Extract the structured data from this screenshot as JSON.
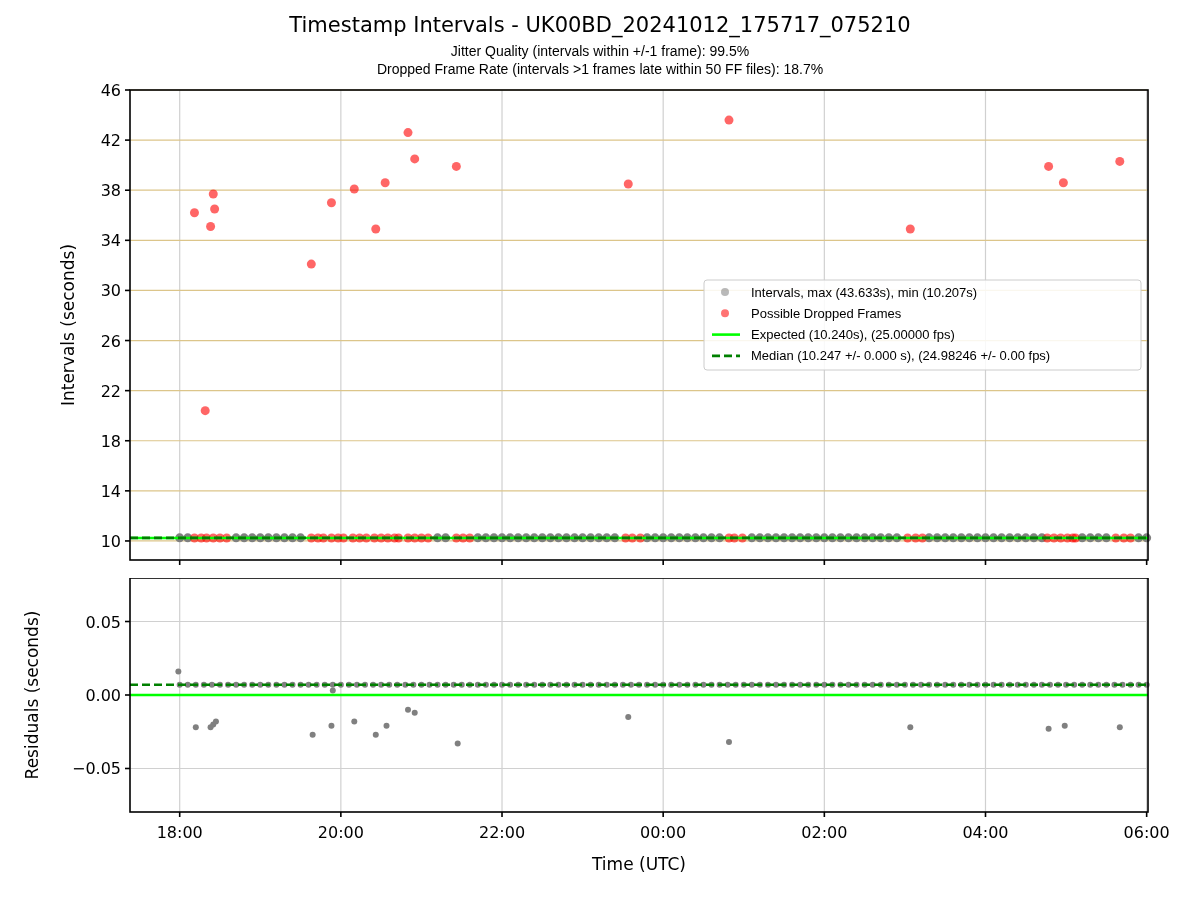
{
  "title": "Timestamp Intervals - UK00BD_20241012_175717_075210",
  "subtitles": [
    "Jitter Quality (intervals within +/-1 frame): 99.5%",
    "Dropped Frame Rate (intervals >1 frames late within 50 FF files): 18.7%"
  ],
  "intervals_chart": {
    "chart_data": {
      "type": "scatter",
      "ylabel": "Intervals (seconds)",
      "xlim": [
        "2024-10-12T17:23",
        "2024-10-13T06:01"
      ],
      "ylim": [
        8.48,
        46
      ],
      "grid": true,
      "legend": true,
      "yticks": [
        10,
        14,
        18,
        22,
        26,
        30,
        34,
        38,
        42,
        46
      ],
      "series": [
        {
          "name": "Intervals, max (43.633s), min (10.207s)",
          "color": "#808080",
          "x": [
            "2024-10-12T18:00",
            "2024-10-12T18:06",
            "2024-10-12T18:42",
            "2024-10-12T18:48",
            "2024-10-12T18:54",
            "2024-10-12T19:00",
            "2024-10-12T19:06",
            "2024-10-12T19:12",
            "2024-10-12T19:18",
            "2024-10-12T19:24",
            "2024-10-12T19:30",
            "2024-10-12T21:12",
            "2024-10-12T21:18",
            "2024-10-12T21:42",
            "2024-10-12T21:48",
            "2024-10-12T21:54",
            "2024-10-12T22:00",
            "2024-10-12T22:06",
            "2024-10-12T22:12",
            "2024-10-12T22:18",
            "2024-10-12T22:24",
            "2024-10-12T22:30",
            "2024-10-12T22:36",
            "2024-10-12T22:42",
            "2024-10-12T22:48",
            "2024-10-12T22:54",
            "2024-10-12T23:00",
            "2024-10-12T23:06",
            "2024-10-12T23:12",
            "2024-10-12T23:18",
            "2024-10-12T23:24",
            "2024-10-12T23:48",
            "2024-10-12T23:54",
            "2024-10-13T00:00",
            "2024-10-13T00:06",
            "2024-10-13T00:12",
            "2024-10-13T00:18",
            "2024-10-13T00:24",
            "2024-10-13T00:30",
            "2024-10-13T00:36",
            "2024-10-13T00:42",
            "2024-10-13T01:06",
            "2024-10-13T01:12",
            "2024-10-13T01:18",
            "2024-10-13T01:24",
            "2024-10-13T01:30",
            "2024-10-13T01:36",
            "2024-10-13T01:42",
            "2024-10-13T01:48",
            "2024-10-13T01:54",
            "2024-10-13T02:00",
            "2024-10-13T02:06",
            "2024-10-13T02:12",
            "2024-10-13T02:18",
            "2024-10-13T02:24",
            "2024-10-13T02:30",
            "2024-10-13T02:36",
            "2024-10-13T02:42",
            "2024-10-13T02:48",
            "2024-10-13T02:54",
            "2024-10-13T03:18",
            "2024-10-13T03:24",
            "2024-10-13T03:30",
            "2024-10-13T03:36",
            "2024-10-13T03:42",
            "2024-10-13T03:48",
            "2024-10-13T03:54",
            "2024-10-13T04:00",
            "2024-10-13T04:06",
            "2024-10-13T04:12",
            "2024-10-13T04:18",
            "2024-10-13T04:24",
            "2024-10-13T04:30",
            "2024-10-13T04:36",
            "2024-10-13T04:42",
            "2024-10-13T05:12",
            "2024-10-13T05:18",
            "2024-10-13T05:24",
            "2024-10-13T05:30",
            "2024-10-13T05:54",
            "2024-10-13T06:00"
          ],
          "values": [
            10.25,
            10.25,
            10.25,
            10.25,
            10.25,
            10.25,
            10.25,
            10.25,
            10.25,
            10.25,
            10.25,
            10.25,
            10.25,
            10.25,
            10.25,
            10.25,
            10.25,
            10.25,
            10.25,
            10.25,
            10.25,
            10.25,
            10.25,
            10.25,
            10.25,
            10.25,
            10.25,
            10.25,
            10.25,
            10.25,
            10.25,
            10.25,
            10.25,
            10.25,
            10.25,
            10.25,
            10.25,
            10.25,
            10.25,
            10.25,
            10.25,
            10.25,
            10.25,
            10.25,
            10.25,
            10.25,
            10.25,
            10.25,
            10.25,
            10.25,
            10.25,
            10.25,
            10.25,
            10.25,
            10.25,
            10.25,
            10.25,
            10.25,
            10.25,
            10.25,
            10.25,
            10.25,
            10.25,
            10.25,
            10.25,
            10.25,
            10.25,
            10.25,
            10.25,
            10.25,
            10.25,
            10.25,
            10.25,
            10.25,
            10.25,
            10.25,
            10.25,
            10.25,
            10.25,
            10.25,
            10.25
          ]
        },
        {
          "name": "Possible Dropped Frames",
          "color": "#ff0000",
          "x": [
            "2024-10-12T18:11",
            "2024-10-12T18:19",
            "2024-10-12T18:23",
            "2024-10-12T18:25",
            "2024-10-12T18:26",
            "2024-10-12T19:38",
            "2024-10-12T19:53",
            "2024-10-12T20:10",
            "2024-10-12T20:26",
            "2024-10-12T20:33",
            "2024-10-12T20:50",
            "2024-10-12T20:55",
            "2024-10-12T21:26",
            "2024-10-12T23:34",
            "2024-10-13T00:49",
            "2024-10-13T03:04",
            "2024-10-13T04:47",
            "2024-10-13T04:58",
            "2024-10-13T05:40",
            "2024-10-12T18:11",
            "2024-10-12T18:16",
            "2024-10-12T18:20",
            "2024-10-12T18:25",
            "2024-10-12T18:30",
            "2024-10-12T18:35",
            "2024-10-12T19:38",
            "2024-10-12T19:43",
            "2024-10-12T19:47",
            "2024-10-12T19:53",
            "2024-10-12T19:58",
            "2024-10-12T20:02",
            "2024-10-12T20:09",
            "2024-10-12T20:14",
            "2024-10-12T20:19",
            "2024-10-12T20:25",
            "2024-10-12T20:30",
            "2024-10-12T20:35",
            "2024-10-12T20:40",
            "2024-10-12T20:43",
            "2024-10-12T20:50",
            "2024-10-12T20:55",
            "2024-10-12T21:00",
            "2024-10-12T21:05",
            "2024-10-12T21:26",
            "2024-10-12T21:31",
            "2024-10-12T21:36",
            "2024-10-12T23:32",
            "2024-10-12T23:37",
            "2024-10-12T23:43",
            "2024-10-13T00:49",
            "2024-10-13T00:53",
            "2024-10-13T00:59",
            "2024-10-13T03:02",
            "2024-10-13T03:08",
            "2024-10-13T03:13",
            "2024-10-13T04:46",
            "2024-10-13T04:51",
            "2024-10-13T04:56",
            "2024-10-13T05:01",
            "2024-10-13T05:05",
            "2024-10-13T05:07",
            "2024-10-13T05:37",
            "2024-10-13T05:43",
            "2024-10-13T05:48"
          ],
          "values": [
            36.2,
            20.4,
            35.1,
            37.7,
            36.5,
            32.1,
            37.0,
            38.1,
            34.9,
            38.6,
            42.6,
            40.5,
            39.9,
            38.5,
            43.6,
            34.9,
            39.9,
            38.6,
            40.3,
            10.24,
            10.24,
            10.24,
            10.24,
            10.24,
            10.24,
            10.24,
            10.24,
            10.24,
            10.24,
            10.24,
            10.24,
            10.24,
            10.24,
            10.24,
            10.24,
            10.24,
            10.24,
            10.24,
            10.24,
            10.24,
            10.24,
            10.24,
            10.24,
            10.24,
            10.24,
            10.24,
            10.24,
            10.24,
            10.24,
            10.24,
            10.24,
            10.24,
            10.24,
            10.24,
            10.24,
            10.24,
            10.24,
            10.24,
            10.24,
            10.24,
            10.24,
            10.24,
            10.24,
            10.24
          ]
        },
        {
          "type": "line",
          "line_style": "solid",
          "name": "Expected (10.240s), (25.00000 fps)",
          "color": "#00ff00",
          "x": [
            "2024-10-12T17:23",
            "2024-10-13T06:01"
          ],
          "values": [
            10.24,
            10.24
          ]
        },
        {
          "type": "line",
          "line_style": "dashed",
          "name": "Median (10.247 +/- 0.000 s), (24.98246 +/- 0.00 fps)",
          "color": "#008000",
          "x": [
            "2024-10-12T17:23",
            "2024-10-13T06:01"
          ],
          "values": [
            10.247,
            10.247
          ]
        }
      ]
    }
  },
  "residuals_chart": {
    "chart_data": {
      "type": "scatter",
      "xlabel": "Time (UTC)",
      "ylabel": "Residuals (seconds)",
      "xlim": [
        "2024-10-12T17:23",
        "2024-10-13T06:01"
      ],
      "ylim": [
        -0.0796,
        0.0796
      ],
      "grid": true,
      "xticks": [
        {
          "value": "2024-10-12T18:00",
          "label": "18:00"
        },
        {
          "value": "2024-10-12T20:00",
          "label": "20:00"
        },
        {
          "value": "2024-10-12T22:00",
          "label": "22:00"
        },
        {
          "value": "2024-10-13T00:00",
          "label": "00:00"
        },
        {
          "value": "2024-10-13T02:00",
          "label": "02:00"
        },
        {
          "value": "2024-10-13T04:00",
          "label": "04:00"
        },
        {
          "value": "2024-10-13T06:00",
          "label": "06:00"
        }
      ],
      "yticks": [
        {
          "value": 0.05,
          "label": "0.05"
        },
        {
          "value": 0,
          "label": "0.00"
        },
        {
          "value": -0.05,
          "label": "−0.05"
        }
      ],
      "series": [
        {
          "color": "#808080",
          "x": [
            "2024-10-12T17:59",
            "2024-10-12T18:12",
            "2024-10-12T18:23",
            "2024-10-12T18:25",
            "2024-10-12T18:27",
            "2024-10-12T19:39",
            "2024-10-12T19:53",
            "2024-10-12T19:54",
            "2024-10-12T20:10",
            "2024-10-12T20:26",
            "2024-10-12T20:34",
            "2024-10-12T20:50",
            "2024-10-12T20:55",
            "2024-10-12T21:27",
            "2024-10-12T23:34",
            "2024-10-13T00:49",
            "2024-10-13T03:04",
            "2024-10-13T04:47",
            "2024-10-13T04:59",
            "2024-10-13T05:40",
            "2024-10-12T18:00",
            "2024-10-12T18:06",
            "2024-10-12T18:12",
            "2024-10-12T18:18",
            "2024-10-12T18:24",
            "2024-10-12T18:30",
            "2024-10-12T18:36",
            "2024-10-12T18:42",
            "2024-10-12T18:48",
            "2024-10-12T18:54",
            "2024-10-12T19:00",
            "2024-10-12T19:06",
            "2024-10-12T19:12",
            "2024-10-12T19:18",
            "2024-10-12T19:24",
            "2024-10-12T19:30",
            "2024-10-12T19:36",
            "2024-10-12T19:42",
            "2024-10-12T19:48",
            "2024-10-12T19:54",
            "2024-10-12T20:00",
            "2024-10-12T20:06",
            "2024-10-12T20:12",
            "2024-10-12T20:18",
            "2024-10-12T20:24",
            "2024-10-12T20:30",
            "2024-10-12T20:36",
            "2024-10-12T20:42",
            "2024-10-12T20:48",
            "2024-10-12T20:54",
            "2024-10-12T21:00",
            "2024-10-12T21:06",
            "2024-10-12T21:12",
            "2024-10-12T21:18",
            "2024-10-12T21:24",
            "2024-10-12T21:30",
            "2024-10-12T21:36",
            "2024-10-12T21:42",
            "2024-10-12T21:48",
            "2024-10-12T21:54",
            "2024-10-12T22:00",
            "2024-10-12T22:06",
            "2024-10-12T22:12",
            "2024-10-12T22:18",
            "2024-10-12T22:24",
            "2024-10-12T22:30",
            "2024-10-12T22:36",
            "2024-10-12T22:42",
            "2024-10-12T22:48",
            "2024-10-12T22:54",
            "2024-10-12T23:00",
            "2024-10-12T23:06",
            "2024-10-12T23:12",
            "2024-10-12T23:18",
            "2024-10-12T23:24",
            "2024-10-12T23:30",
            "2024-10-12T23:36",
            "2024-10-12T23:42",
            "2024-10-12T23:48",
            "2024-10-12T23:54",
            "2024-10-13T00:00",
            "2024-10-13T00:06",
            "2024-10-13T00:12",
            "2024-10-13T00:18",
            "2024-10-13T00:24",
            "2024-10-13T00:30",
            "2024-10-13T00:36",
            "2024-10-13T00:42",
            "2024-10-13T00:48",
            "2024-10-13T00:54",
            "2024-10-13T01:00",
            "2024-10-13T01:06",
            "2024-10-13T01:12",
            "2024-10-13T01:18",
            "2024-10-13T01:24",
            "2024-10-13T01:30",
            "2024-10-13T01:36",
            "2024-10-13T01:42",
            "2024-10-13T01:48",
            "2024-10-13T01:54",
            "2024-10-13T02:00",
            "2024-10-13T02:06",
            "2024-10-13T02:12",
            "2024-10-13T02:18",
            "2024-10-13T02:24",
            "2024-10-13T02:30",
            "2024-10-13T02:36",
            "2024-10-13T02:42",
            "2024-10-13T02:48",
            "2024-10-13T02:54",
            "2024-10-13T03:00",
            "2024-10-13T03:06",
            "2024-10-13T03:12",
            "2024-10-13T03:18",
            "2024-10-13T03:24",
            "2024-10-13T03:30",
            "2024-10-13T03:36",
            "2024-10-13T03:42",
            "2024-10-13T03:48",
            "2024-10-13T03:54",
            "2024-10-13T04:00",
            "2024-10-13T04:06",
            "2024-10-13T04:12",
            "2024-10-13T04:18",
            "2024-10-13T04:24",
            "2024-10-13T04:30",
            "2024-10-13T04:36",
            "2024-10-13T04:42",
            "2024-10-13T04:48",
            "2024-10-13T04:54",
            "2024-10-13T05:00",
            "2024-10-13T05:06",
            "2024-10-13T05:12",
            "2024-10-13T05:18",
            "2024-10-13T05:24",
            "2024-10-13T05:30",
            "2024-10-13T05:36",
            "2024-10-13T05:42",
            "2024-10-13T05:48",
            "2024-10-13T05:54",
            "2024-10-13T06:00"
          ],
          "values": [
            0.016,
            -0.022,
            -0.022,
            -0.02,
            -0.018,
            -0.027,
            -0.021,
            0.003,
            -0.018,
            -0.027,
            -0.021,
            -0.01,
            -0.012,
            -0.033,
            -0.015,
            -0.032,
            -0.022,
            -0.023,
            -0.021,
            -0.022,
            0.007,
            0.007,
            0.007,
            0.007,
            0.007,
            0.007,
            0.007,
            0.007,
            0.007,
            0.007,
            0.007,
            0.007,
            0.007,
            0.007,
            0.007,
            0.007,
            0.007,
            0.007,
            0.007,
            0.007,
            0.007,
            0.007,
            0.007,
            0.007,
            0.007,
            0.007,
            0.007,
            0.007,
            0.007,
            0.007,
            0.007,
            0.007,
            0.007,
            0.007,
            0.007,
            0.007,
            0.007,
            0.007,
            0.007,
            0.007,
            0.007,
            0.007,
            0.007,
            0.007,
            0.007,
            0.007,
            0.007,
            0.007,
            0.007,
            0.007,
            0.007,
            0.007,
            0.007,
            0.007,
            0.007,
            0.007,
            0.007,
            0.007,
            0.007,
            0.007,
            0.007,
            0.007,
            0.007,
            0.007,
            0.007,
            0.007,
            0.007,
            0.007,
            0.007,
            0.007,
            0.007,
            0.007,
            0.007,
            0.007,
            0.007,
            0.007,
            0.007,
            0.007,
            0.007,
            0.007,
            0.007,
            0.007,
            0.007,
            0.007,
            0.007,
            0.007,
            0.007,
            0.007,
            0.007,
            0.007,
            0.007,
            0.007,
            0.007,
            0.007,
            0.007,
            0.007,
            0.007,
            0.007,
            0.007,
            0.007,
            0.007,
            0.007,
            0.007,
            0.007,
            0.007,
            0.007,
            0.007,
            0.007,
            0.007,
            0.007,
            0.007,
            0.007,
            0.007,
            0.007,
            0.007,
            0.007,
            0.007,
            0.007,
            0.007,
            0.007,
            0.007
          ]
        },
        {
          "type": "line",
          "line_style": "solid",
          "color": "#00ff00",
          "x": [
            "2024-10-12T17:23",
            "2024-10-13T06:01"
          ],
          "values": [
            0,
            0
          ]
        },
        {
          "type": "line",
          "line_style": "dashed",
          "color": "#008000",
          "x": [
            "2024-10-12T17:23",
            "2024-10-13T06:01"
          ],
          "values": [
            0.007,
            0.007
          ]
        }
      ]
    }
  }
}
